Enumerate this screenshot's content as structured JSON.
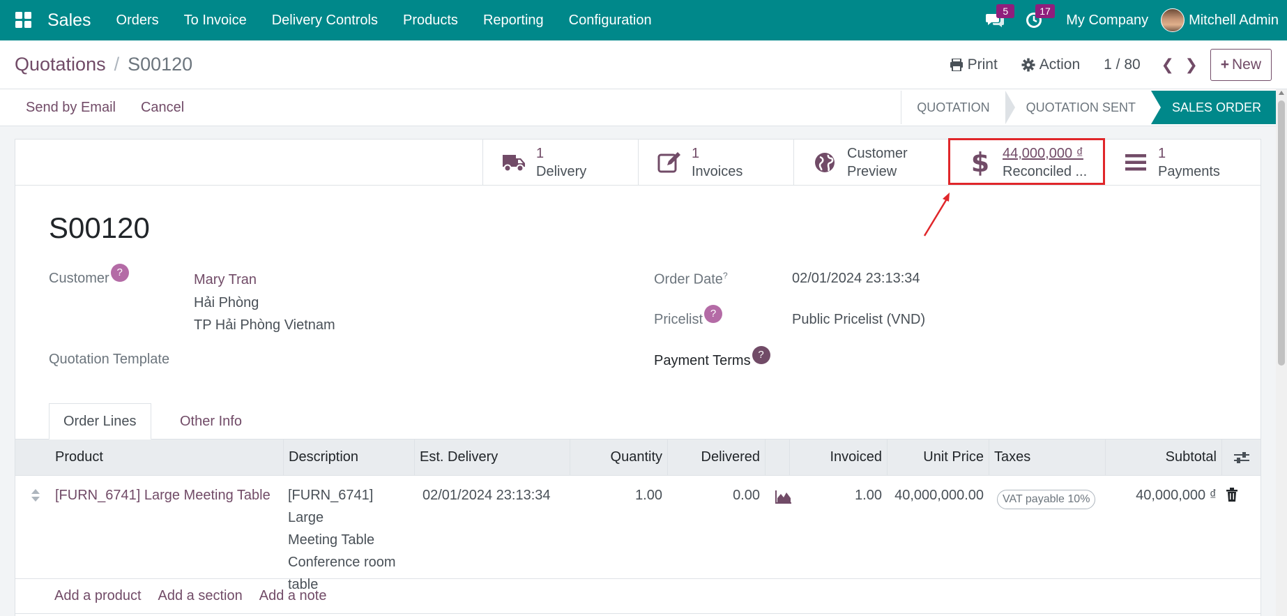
{
  "navbar": {
    "app_name": "Sales",
    "menus": [
      "Orders",
      "To Invoice",
      "Delivery Controls",
      "Products",
      "Reporting",
      "Configuration"
    ],
    "messages_count": "5",
    "activities_count": "17",
    "company": "My Company",
    "user": "Mitchell Admin"
  },
  "breadcrumb": {
    "parent": "Quotations",
    "separator": "/",
    "current": "S00120"
  },
  "control": {
    "print_label": "Print",
    "action_label": "Action",
    "pager": "1 / 80",
    "new_label": "New"
  },
  "statusbar": {
    "buttons": [
      "Send by Email",
      "Cancel"
    ],
    "stages": [
      "QUOTATION",
      "QUOTATION SENT",
      "SALES ORDER"
    ],
    "current_stage": "SALES ORDER"
  },
  "smart_buttons": [
    {
      "value": "1",
      "label": "Delivery",
      "icon": "truck-icon"
    },
    {
      "value": "1",
      "label": "Invoices",
      "icon": "edit-icon"
    },
    {
      "value": "Customer",
      "label": "Preview",
      "icon": "globe-icon"
    },
    {
      "value": "44,000,000 ₫",
      "label": "Reconciled ...",
      "icon": "dollar-icon"
    },
    {
      "value": "1",
      "label": "Payments",
      "icon": "list-icon"
    }
  ],
  "form": {
    "title": "S00120",
    "customer_label": "Customer",
    "customer_name": "Mary Tran",
    "customer_city": "Hải Phòng",
    "customer_region": "TP Hải Phòng Vietnam",
    "template_label": "Quotation Template",
    "order_date_label": "Order Date",
    "order_date": "02/01/2024 23:13:34",
    "pricelist_label": "Pricelist",
    "pricelist": "Public Pricelist (VND)",
    "payment_terms_label": "Payment Terms",
    "help_glyph": "?"
  },
  "tabs": [
    "Order Lines",
    "Other Info"
  ],
  "table": {
    "headers": [
      "Product",
      "Description",
      "Est. Delivery",
      "Quantity",
      "Delivered",
      "Invoiced",
      "Unit Price",
      "Taxes",
      "Subtotal"
    ],
    "rows": [
      {
        "product": "[FURN_6741] Large Meeting Table",
        "description_lines": [
          "[FURN_6741] Large",
          "Meeting Table",
          "Conference room",
          "table"
        ],
        "est_delivery": "02/01/2024 23:13:34",
        "quantity": "1.00",
        "delivered": "0.00",
        "invoiced": "1.00",
        "unit_price": "40,000,000.00",
        "tax": "VAT payable 10%",
        "subtotal": "40,000,000 ₫"
      }
    ],
    "add_links": [
      "Add a product",
      "Add a section",
      "Add a note"
    ]
  },
  "colors": {
    "navbar": "#00888a",
    "accent": "#714b67",
    "highlight": "#e0262a"
  }
}
